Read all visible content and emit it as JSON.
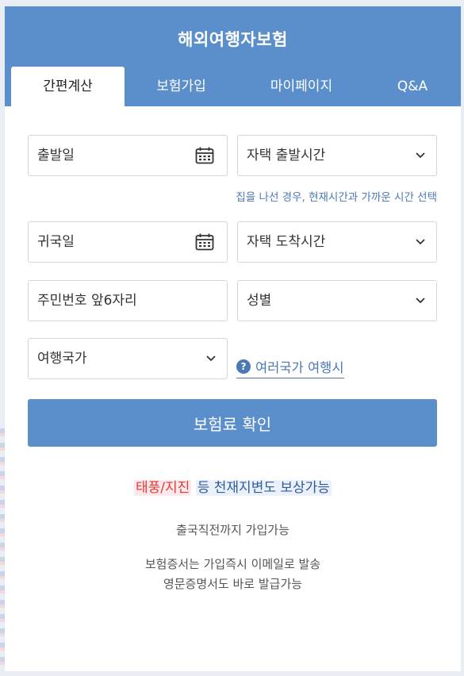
{
  "header": {
    "title": "해외여행자보험"
  },
  "tabs": [
    {
      "label": "간편계산",
      "active": true
    },
    {
      "label": "보험가입",
      "active": false
    },
    {
      "label": "마이페이지",
      "active": false
    },
    {
      "label": "Q&A",
      "active": false
    }
  ],
  "form": {
    "departure_date": {
      "placeholder": "출발일",
      "icon": "calendar-icon"
    },
    "departure_time": {
      "placeholder": "자택 출발시간",
      "icon": "chevron-down-icon"
    },
    "departure_help": "집을 나선 경우, 현재시간과 가까운 시간 선택",
    "return_date": {
      "placeholder": "귀국일",
      "icon": "calendar-icon"
    },
    "arrival_time": {
      "placeholder": "자택 도착시간",
      "icon": "chevron-down-icon"
    },
    "resident_number": {
      "placeholder": "주민번호 앞6자리"
    },
    "gender": {
      "placeholder": "성별",
      "icon": "chevron-down-icon"
    },
    "country": {
      "placeholder": "여행국가",
      "icon": "chevron-down-icon"
    },
    "multi_country_link": "여러국가 여행시",
    "help_badge": "?"
  },
  "submit_label": "보험료 확인",
  "promo": {
    "highlight": "태풍/지진",
    "rest": "등 천재지변도 보상가능"
  },
  "notes": {
    "line1": "출국직전까지 가입가능",
    "line2": "보험증서는 가입즉시 이메일로 발송",
    "line3": "영문증명서도 바로 발급가능"
  },
  "colors": {
    "primary": "#5b8fcb",
    "link": "#4a79b5",
    "promo_red": "#e53935",
    "promo_blue": "#2f5c99"
  }
}
